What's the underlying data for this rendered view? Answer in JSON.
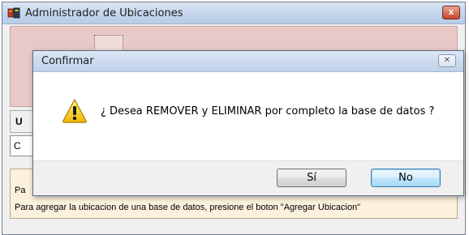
{
  "main_window": {
    "title": "Administrador de Ubicaciones",
    "close_label": "x",
    "section_header_label": "U",
    "combo_value": "C",
    "info_lines": [
      "Pa",
      "Para agregar la ubicacion de una base de datos, presione el boton \"Agregar Ubicacion\""
    ]
  },
  "dialog": {
    "title": "Confirmar",
    "close_label": "✕",
    "message": "¿ Desea REMOVER y ELIMINAR por completo la base de datos ?",
    "buttons": {
      "yes": "Sí",
      "no": "No"
    }
  },
  "icons": {
    "app": "app-icon",
    "warning": "warning-icon",
    "close": "close-icon"
  },
  "colors": {
    "toolbar_bg": "#e8c9c7",
    "info_bg": "#fbf1dc",
    "default_button_border": "#3c7fb1",
    "main_close_bg": "#c7462a"
  }
}
